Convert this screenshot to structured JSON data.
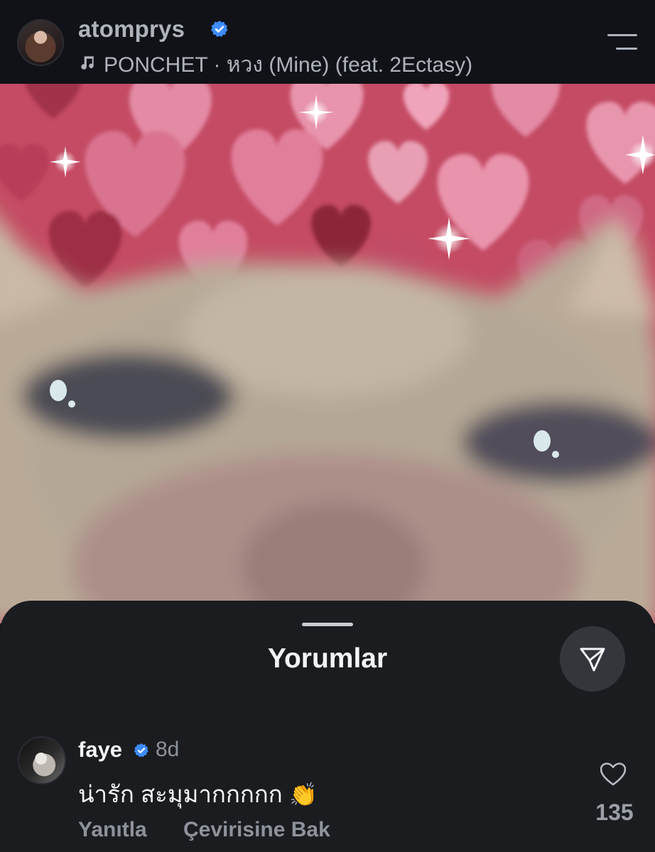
{
  "header": {
    "username": "atomprys",
    "music_icon": "music-note-icon",
    "music_label": "PONCHET · หวง (Mine) (feat. 2Ectasy)",
    "menu_icon": "menu-icon"
  },
  "media": {
    "icon": "cat-with-hearts-image"
  },
  "comments_sheet": {
    "title": "Yorumlar",
    "share_icon": "send-icon"
  },
  "comments": [
    {
      "username": "faye",
      "time": "8d",
      "text": "น่ารัก สะมุมากกกกก",
      "emoji": "👏",
      "reply_label": "Yanıtla",
      "translate_label": "Çevirisine Bak",
      "like_count": "135"
    }
  ],
  "colors": {
    "verified": "#3d8bff",
    "header_bg": "#101217",
    "sheet_bg": "#1a1c20"
  }
}
